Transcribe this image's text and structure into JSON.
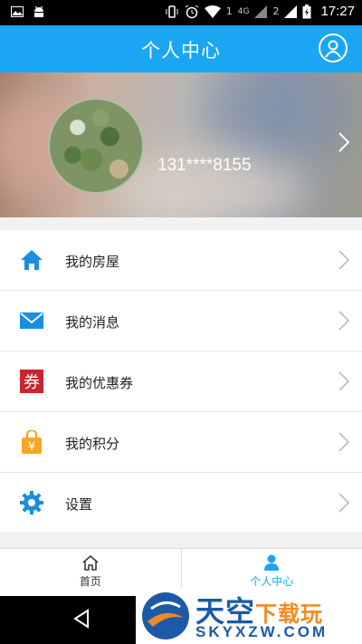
{
  "status_bar": {
    "network": "4G",
    "sim1": "1",
    "sim2": "2",
    "time": "17:27",
    "icons": [
      "image-icon",
      "android-icon",
      "vibrate-icon",
      "alarm-icon",
      "wifi-icon",
      "signal-icon",
      "battery-charging-icon"
    ]
  },
  "header": {
    "title": "个人中心",
    "accent_color": "#1aa6f2"
  },
  "profile": {
    "phone": "131****8155"
  },
  "menu": {
    "items": [
      {
        "label": "我的房屋",
        "icon": "home-icon"
      },
      {
        "label": "我的消息",
        "icon": "mail-icon"
      },
      {
        "label": "我的优惠券",
        "icon": "coupon-icon"
      },
      {
        "label": "我的积分",
        "icon": "points-bag-icon"
      },
      {
        "label": "设置",
        "icon": "gear-icon"
      }
    ]
  },
  "bottom_nav": {
    "tabs": [
      {
        "label": "首页",
        "icon": "home-outline-icon",
        "active": false
      },
      {
        "label": "个人中心",
        "icon": "person-icon",
        "active": true
      }
    ]
  },
  "watermark": {
    "title_a": "天空",
    "title_b": "下载玩",
    "domain": "SKYXZW.COM"
  }
}
